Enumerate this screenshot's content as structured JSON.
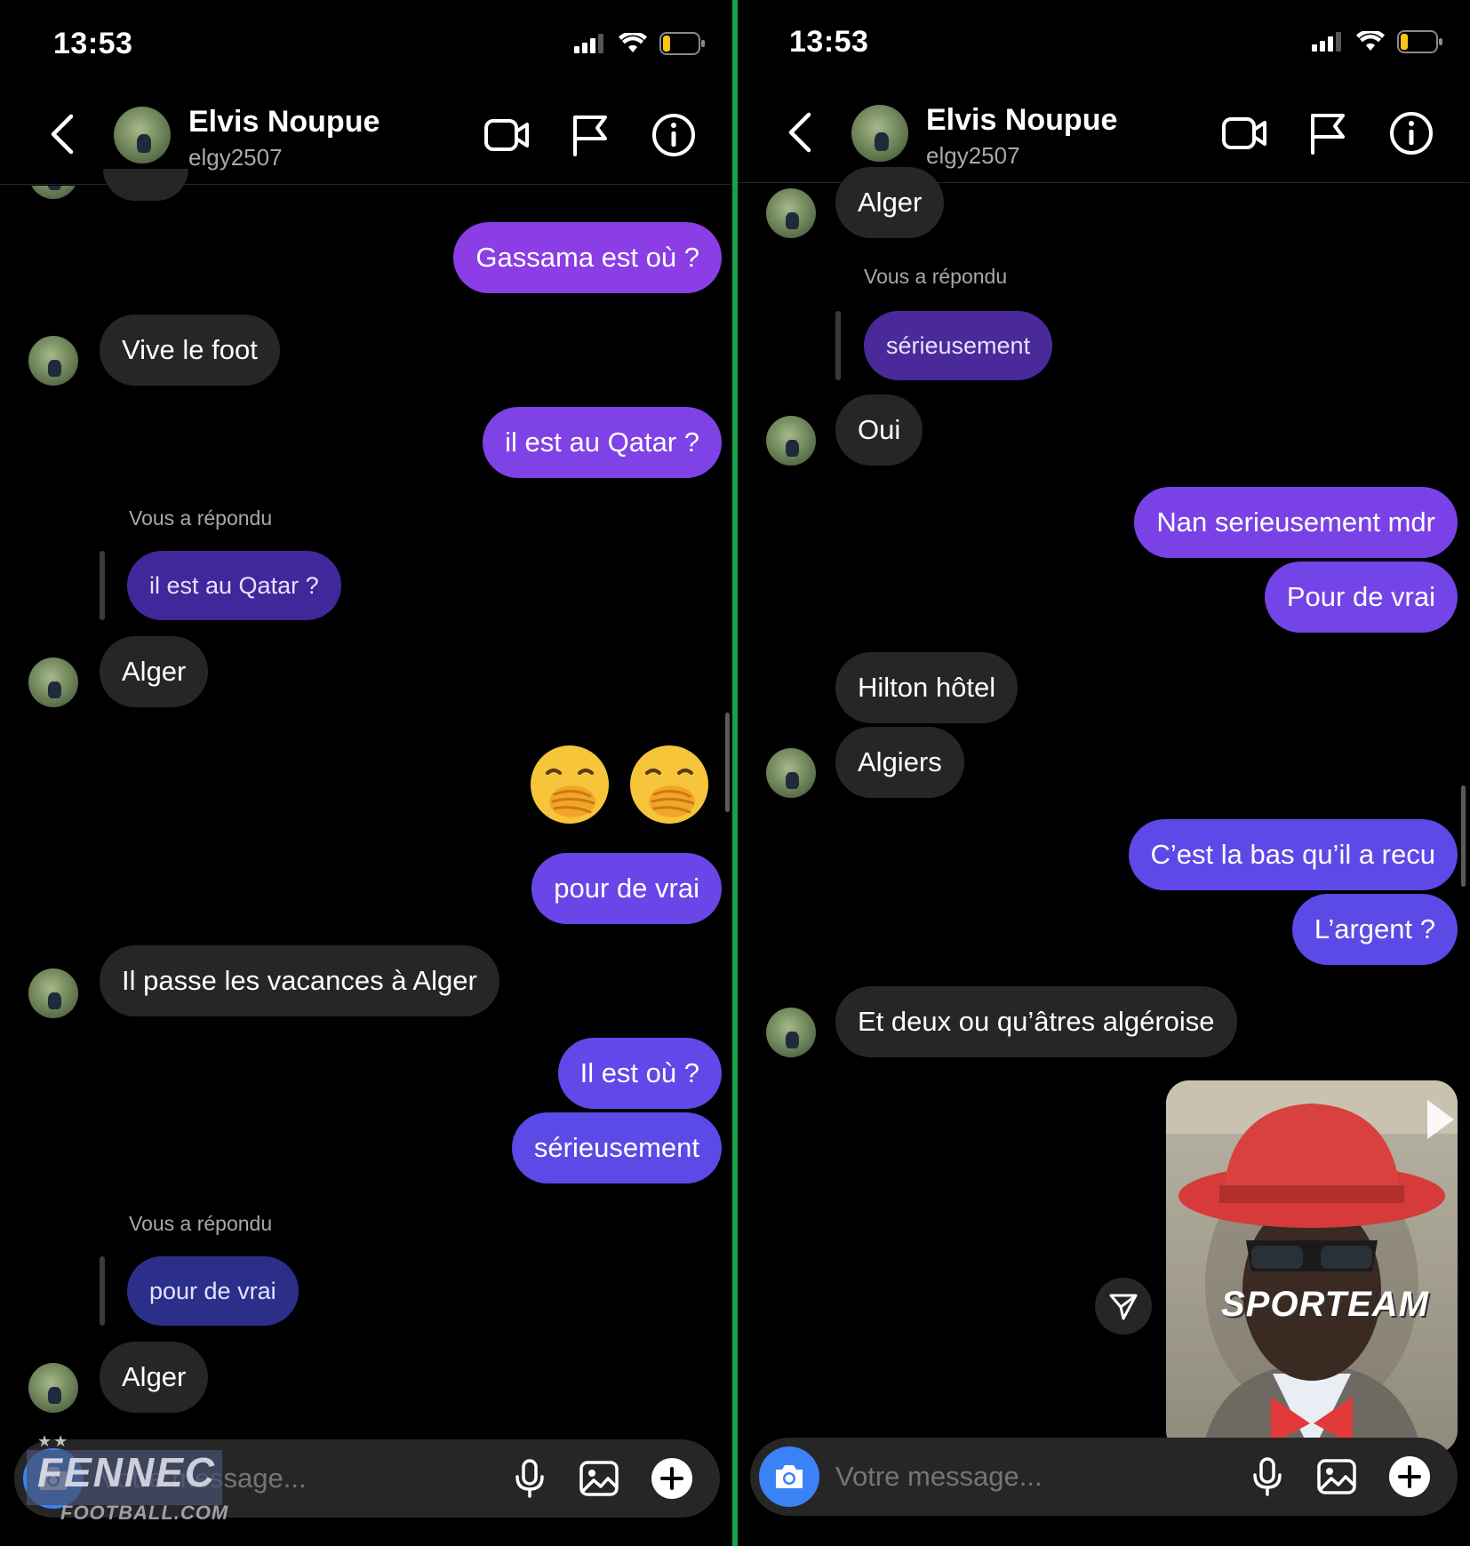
{
  "screens": [
    {
      "status": {
        "time": "13:53"
      },
      "header": {
        "name": "Elvis Noupue",
        "username": "elgy2507"
      },
      "messages": {
        "out_1": "Gassama est où ?",
        "in_1": "Vive le foot",
        "out_2": "il est au Qatar ?",
        "reply_label_1": "Vous a répondu",
        "reply_1": "il est au Qatar ?",
        "in_2": "Alger",
        "emoji": "🤭 🤭",
        "out_3": "pour de vrai",
        "in_3": "Il passe les vacances à Alger",
        "out_4": "Il est où ?",
        "out_5": "sérieusement",
        "reply_label_2": "Vous a répondu",
        "reply_2": "pour de vrai",
        "in_4": "Alger"
      },
      "composer": {
        "placeholder": "Votre message..."
      }
    },
    {
      "status": {
        "time": "13:53"
      },
      "header": {
        "name": "Elvis Noupue",
        "username": "elgy2507"
      },
      "messages": {
        "in_1": "Alger",
        "reply_label_1": "Vous a répondu",
        "reply_1": "sérieusement",
        "in_2": "Oui",
        "out_1": "Nan serieusement mdr",
        "out_2": "Pour de vrai",
        "in_3": "Hilton hôtel",
        "in_4": "Algiers",
        "out_3": "C’est la bas qu’il a recu",
        "out_4": "L’argent ?",
        "in_5": "Et deux ou qu’âtres algéroise",
        "video_brand": "SPORTEAM"
      },
      "composer": {
        "placeholder": "Votre message..."
      }
    }
  ],
  "watermark": {
    "brand": "FENNEC",
    "site": "FOOTBALL.COM",
    "stars": "★★"
  },
  "colors": {
    "out_top": "#9b3fe0",
    "out_bottom": "#5b4ae6",
    "reply_bubble": "#3d2a86",
    "incoming": "#262626",
    "divider": "#17a34a",
    "camera_button": "#3b82f6"
  }
}
